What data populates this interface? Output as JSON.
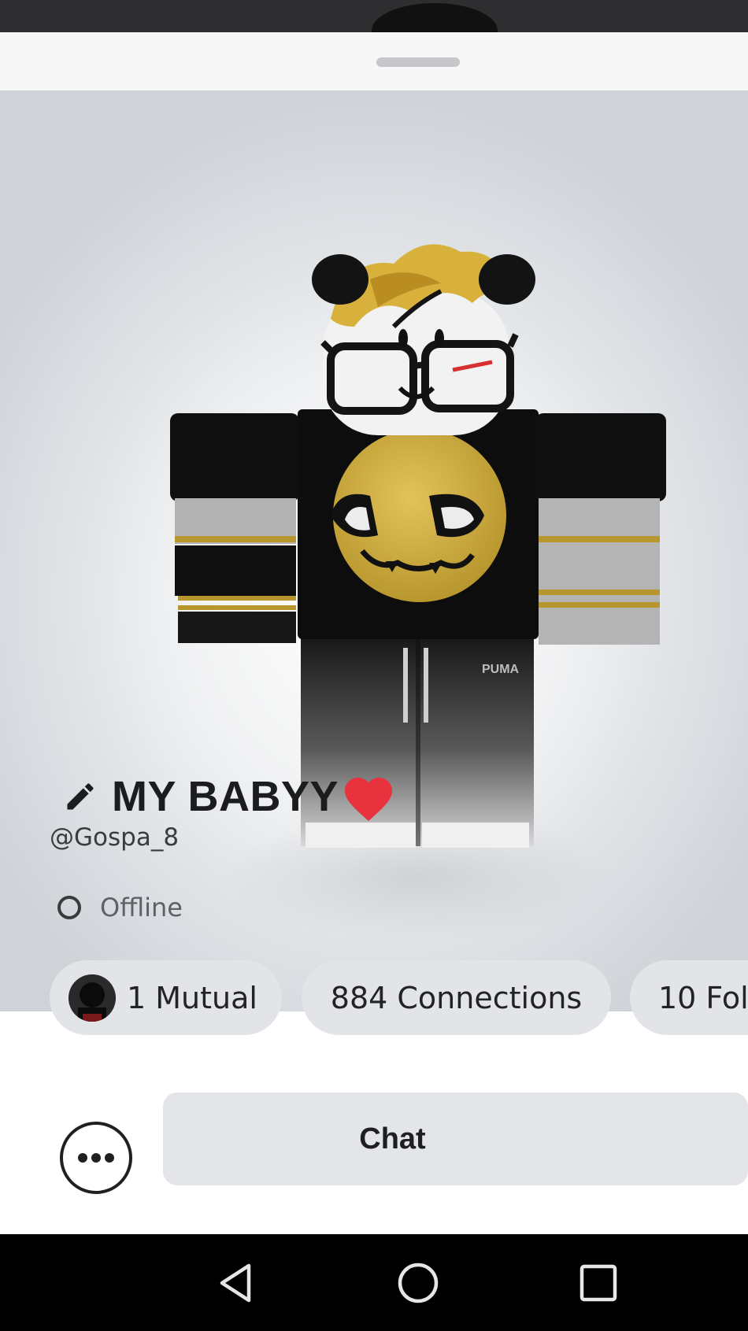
{
  "profile": {
    "display_name": "MY BABYY",
    "username": "@Gospa_8",
    "presence": "Offline"
  },
  "stats": {
    "mutual": "1 Mutual",
    "connections": "884 Connections",
    "followers": "10 Foll"
  },
  "actions": {
    "chat_label": "Chat"
  },
  "avatar": {
    "shirt_brand_text": "PUMA"
  },
  "colors": {
    "heart": "#e8333f",
    "pill_bg": "#e3e4e7",
    "chat_bg": "#e4e5e8",
    "text_dark": "#1b1c1e"
  },
  "icons": {
    "edit": "pencil-icon",
    "heart": "heart-icon",
    "presence": "offline-ring-icon",
    "more": "more-options-icon",
    "nav_back": "back-triangle-icon",
    "nav_home": "home-circle-icon",
    "nav_recents": "recents-square-icon"
  }
}
